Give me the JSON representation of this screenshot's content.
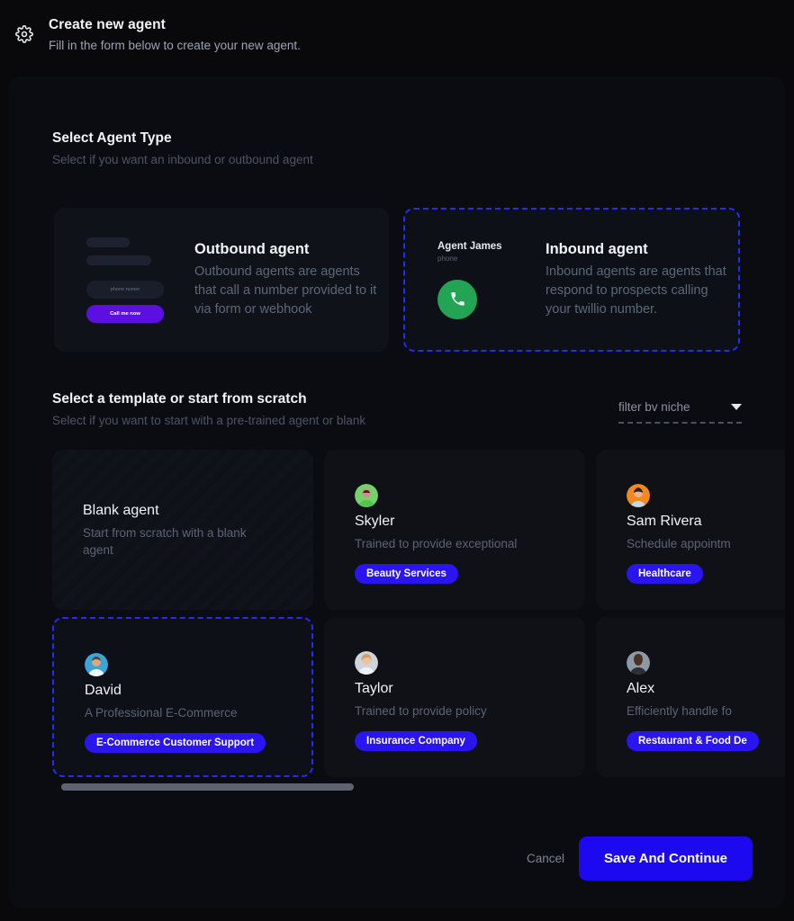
{
  "header": {
    "icon": "gear-icon",
    "title": "Create new agent",
    "subtitle": "Fill in the form below to create your new agent."
  },
  "agent_type_section": {
    "title": "Select Agent Type",
    "subtitle": "Select if you want an inbound or outbound agent",
    "cards": [
      {
        "id": "outbound",
        "name": "Outbound agent",
        "description": "Outbound agents are agents that call a number provided to it via form or webhook",
        "selected": false,
        "mock": {
          "input_placeholder": "phone numer",
          "button_label": "Call me now"
        }
      },
      {
        "id": "inbound",
        "name": "Inbound agent",
        "description": "Inbound agents are agents that respond to prospects calling your twillio number.",
        "selected": true,
        "mock": {
          "agent_name": "Agent James",
          "agent_label": "phone",
          "call_icon": "phone-icon"
        }
      }
    ]
  },
  "template_section": {
    "title": "Select a template or start from scratch",
    "subtitle": "Select if you want to start with a pre-trained agent or blank",
    "filter": {
      "label": "filter bv niche",
      "icon": "chevron-down-icon"
    },
    "cards": [
      {
        "id": "blank",
        "name": "Blank agent",
        "description": "Start from scratch with a blank agent",
        "badge": "",
        "selected": false,
        "avatar_color": ""
      },
      {
        "id": "skyler",
        "name": "Skyler",
        "description": "Trained to provide exceptional",
        "badge": "Beauty Services",
        "selected": false,
        "avatar_color": "#72d36a"
      },
      {
        "id": "sam-rivera",
        "name": "Sam Rivera",
        "description": "Schedule appointm",
        "badge": "Healthcare",
        "selected": false,
        "avatar_color": "#f08a1e"
      },
      {
        "id": "david",
        "name": "David",
        "description": "A Professional E-Commerce",
        "badge": "E-Commerce Customer Support",
        "selected": true,
        "avatar_color": "#3aa6d8"
      },
      {
        "id": "taylor",
        "name": "Taylor",
        "description": "Trained to provide policy",
        "badge": "Insurance Company",
        "selected": false,
        "avatar_color": "#cfd4dc"
      },
      {
        "id": "alex",
        "name": "Alex",
        "description": "Efficiently handle fo",
        "badge": "Restaurant & Food De",
        "selected": false,
        "avatar_color": "#8d9aa6"
      }
    ]
  },
  "footer": {
    "cancel_label": "Cancel",
    "save_label": "Save And Continue"
  },
  "colors": {
    "accent_blue": "#2a14ef",
    "selected_border": "#2a2af5",
    "call_green": "#23a455",
    "mock_button_purple": "#5b0fe0",
    "page_background": "#09090b",
    "panel_background": "#0b0c12",
    "card_background": "#0f1117"
  }
}
